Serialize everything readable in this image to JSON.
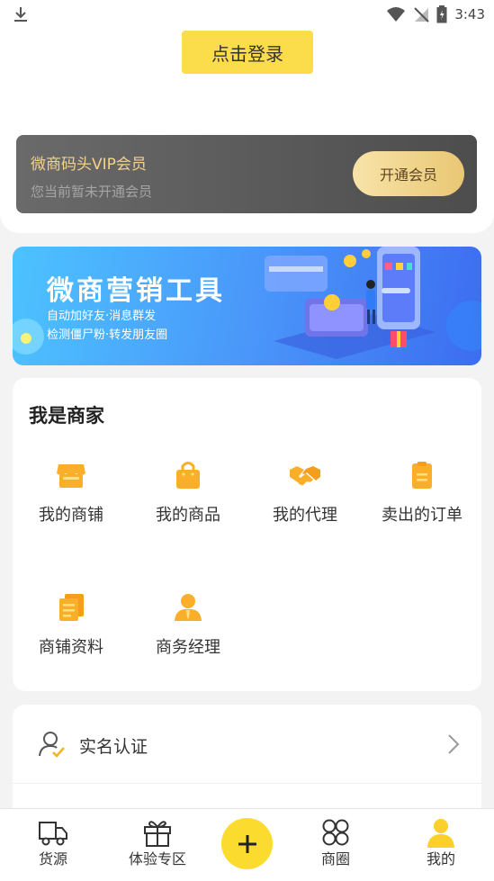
{
  "status_bar": {
    "time": "3:43"
  },
  "login": {
    "button_label": "点击登录"
  },
  "vip": {
    "title": "微商码头VIP会员",
    "subtitle": "您当前暂未开通会员",
    "button_label": "开通会员"
  },
  "banner": {
    "title": "微商营销工具",
    "line1": "自动加好友·消息群发",
    "line2": "检测僵尸粉·转发朋友圈"
  },
  "merchant": {
    "title": "我是商家",
    "items": [
      {
        "label": "我的商铺",
        "icon": "store-icon"
      },
      {
        "label": "我的商品",
        "icon": "shopping-bag-icon"
      },
      {
        "label": "我的代理",
        "icon": "handshake-icon"
      },
      {
        "label": "卖出的订单",
        "icon": "clipboard-icon"
      },
      {
        "label": "商铺资料",
        "icon": "documents-icon"
      },
      {
        "label": "商务经理",
        "icon": "manager-icon"
      }
    ]
  },
  "list": {
    "real_name_label": "实名认证"
  },
  "tabs": [
    {
      "label": "货源",
      "icon": "truck-icon"
    },
    {
      "label": "体验专区",
      "icon": "gift-icon"
    },
    {
      "label": "商圈",
      "icon": "grid-icon"
    },
    {
      "label": "我的",
      "icon": "user-icon"
    }
  ],
  "colors": {
    "accent_yellow": "#fbdc4a",
    "icon_orange": "#fbae2a",
    "vip_gold": "#f3d28a"
  }
}
